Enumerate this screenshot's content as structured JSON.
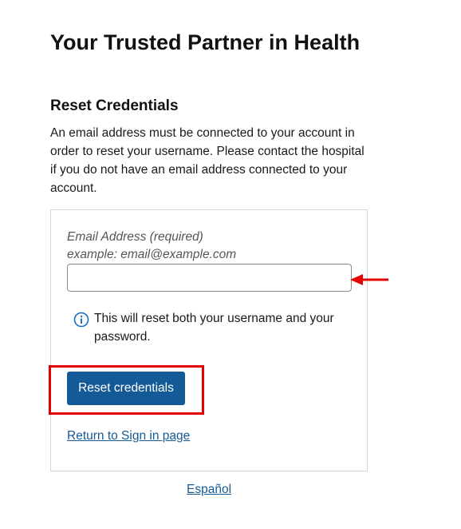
{
  "header": {
    "title": "Your Trusted Partner in Health"
  },
  "reset": {
    "heading": "Reset Credentials",
    "intro": "An email address must be connected to your account in order to reset your username. Please contact the hospital if you do not have an email address connected to your account.",
    "email_label": "Email Address (required)",
    "email_example": "example: email@example.com",
    "email_value": "",
    "info_icon": "info-circle-icon",
    "info_text": "This will reset both your username and your password.",
    "submit_label": "Reset credentials",
    "return_link": "Return to Sign in page"
  },
  "footer": {
    "language_link": "Español"
  },
  "colors": {
    "primary": "#145a96",
    "annotation": "#e30000",
    "info_icon": "#1a6ec2"
  }
}
